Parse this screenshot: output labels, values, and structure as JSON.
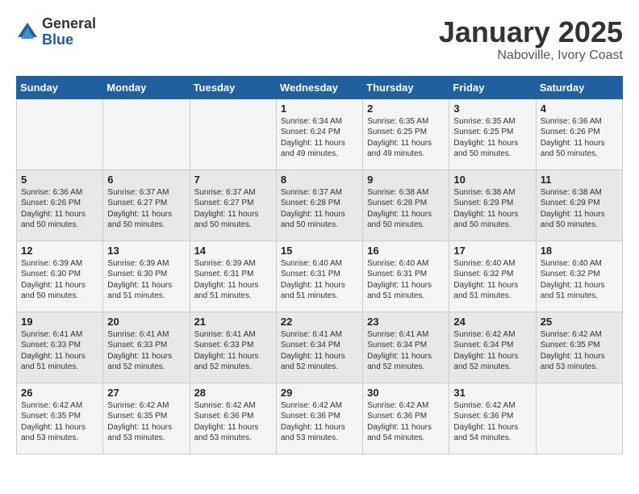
{
  "header": {
    "logo_general": "General",
    "logo_blue": "Blue",
    "month": "January 2025",
    "location": "Naboville, Ivory Coast"
  },
  "days_of_week": [
    "Sunday",
    "Monday",
    "Tuesday",
    "Wednesday",
    "Thursday",
    "Friday",
    "Saturday"
  ],
  "weeks": [
    [
      {
        "day": "",
        "info": ""
      },
      {
        "day": "",
        "info": ""
      },
      {
        "day": "",
        "info": ""
      },
      {
        "day": "1",
        "info": "Sunrise: 6:34 AM\nSunset: 6:24 PM\nDaylight: 11 hours\nand 49 minutes."
      },
      {
        "day": "2",
        "info": "Sunrise: 6:35 AM\nSunset: 6:25 PM\nDaylight: 11 hours\nand 49 minutes."
      },
      {
        "day": "3",
        "info": "Sunrise: 6:35 AM\nSunset: 6:25 PM\nDaylight: 11 hours\nand 50 minutes."
      },
      {
        "day": "4",
        "info": "Sunrise: 6:36 AM\nSunset: 6:26 PM\nDaylight: 11 hours\nand 50 minutes."
      }
    ],
    [
      {
        "day": "5",
        "info": "Sunrise: 6:36 AM\nSunset: 6:26 PM\nDaylight: 11 hours\nand 50 minutes."
      },
      {
        "day": "6",
        "info": "Sunrise: 6:37 AM\nSunset: 6:27 PM\nDaylight: 11 hours\nand 50 minutes."
      },
      {
        "day": "7",
        "info": "Sunrise: 6:37 AM\nSunset: 6:27 PM\nDaylight: 11 hours\nand 50 minutes."
      },
      {
        "day": "8",
        "info": "Sunrise: 6:37 AM\nSunset: 6:28 PM\nDaylight: 11 hours\nand 50 minutes."
      },
      {
        "day": "9",
        "info": "Sunrise: 6:38 AM\nSunset: 6:28 PM\nDaylight: 11 hours\nand 50 minutes."
      },
      {
        "day": "10",
        "info": "Sunrise: 6:38 AM\nSunset: 6:29 PM\nDaylight: 11 hours\nand 50 minutes."
      },
      {
        "day": "11",
        "info": "Sunrise: 6:38 AM\nSunset: 6:29 PM\nDaylight: 11 hours\nand 50 minutes."
      }
    ],
    [
      {
        "day": "12",
        "info": "Sunrise: 6:39 AM\nSunset: 6:30 PM\nDaylight: 11 hours\nand 50 minutes."
      },
      {
        "day": "13",
        "info": "Sunrise: 6:39 AM\nSunset: 6:30 PM\nDaylight: 11 hours\nand 51 minutes."
      },
      {
        "day": "14",
        "info": "Sunrise: 6:39 AM\nSunset: 6:31 PM\nDaylight: 11 hours\nand 51 minutes."
      },
      {
        "day": "15",
        "info": "Sunrise: 6:40 AM\nSunset: 6:31 PM\nDaylight: 11 hours\nand 51 minutes."
      },
      {
        "day": "16",
        "info": "Sunrise: 6:40 AM\nSunset: 6:31 PM\nDaylight: 11 hours\nand 51 minutes."
      },
      {
        "day": "17",
        "info": "Sunrise: 6:40 AM\nSunset: 6:32 PM\nDaylight: 11 hours\nand 51 minutes."
      },
      {
        "day": "18",
        "info": "Sunrise: 6:40 AM\nSunset: 6:32 PM\nDaylight: 11 hours\nand 51 minutes."
      }
    ],
    [
      {
        "day": "19",
        "info": "Sunrise: 6:41 AM\nSunset: 6:33 PM\nDaylight: 11 hours\nand 51 minutes."
      },
      {
        "day": "20",
        "info": "Sunrise: 6:41 AM\nSunset: 6:33 PM\nDaylight: 11 hours\nand 52 minutes."
      },
      {
        "day": "21",
        "info": "Sunrise: 6:41 AM\nSunset: 6:33 PM\nDaylight: 11 hours\nand 52 minutes."
      },
      {
        "day": "22",
        "info": "Sunrise: 6:41 AM\nSunset: 6:34 PM\nDaylight: 11 hours\nand 52 minutes."
      },
      {
        "day": "23",
        "info": "Sunrise: 6:41 AM\nSunset: 6:34 PM\nDaylight: 11 hours\nand 52 minutes."
      },
      {
        "day": "24",
        "info": "Sunrise: 6:42 AM\nSunset: 6:34 PM\nDaylight: 11 hours\nand 52 minutes."
      },
      {
        "day": "25",
        "info": "Sunrise: 6:42 AM\nSunset: 6:35 PM\nDaylight: 11 hours\nand 53 minutes."
      }
    ],
    [
      {
        "day": "26",
        "info": "Sunrise: 6:42 AM\nSunset: 6:35 PM\nDaylight: 11 hours\nand 53 minutes."
      },
      {
        "day": "27",
        "info": "Sunrise: 6:42 AM\nSunset: 6:35 PM\nDaylight: 11 hours\nand 53 minutes."
      },
      {
        "day": "28",
        "info": "Sunrise: 6:42 AM\nSunset: 6:36 PM\nDaylight: 11 hours\nand 53 minutes."
      },
      {
        "day": "29",
        "info": "Sunrise: 6:42 AM\nSunset: 6:36 PM\nDaylight: 11 hours\nand 53 minutes."
      },
      {
        "day": "30",
        "info": "Sunrise: 6:42 AM\nSunset: 6:36 PM\nDaylight: 11 hours\nand 54 minutes."
      },
      {
        "day": "31",
        "info": "Sunrise: 6:42 AM\nSunset: 6:36 PM\nDaylight: 11 hours\nand 54 minutes."
      },
      {
        "day": "",
        "info": ""
      }
    ]
  ]
}
